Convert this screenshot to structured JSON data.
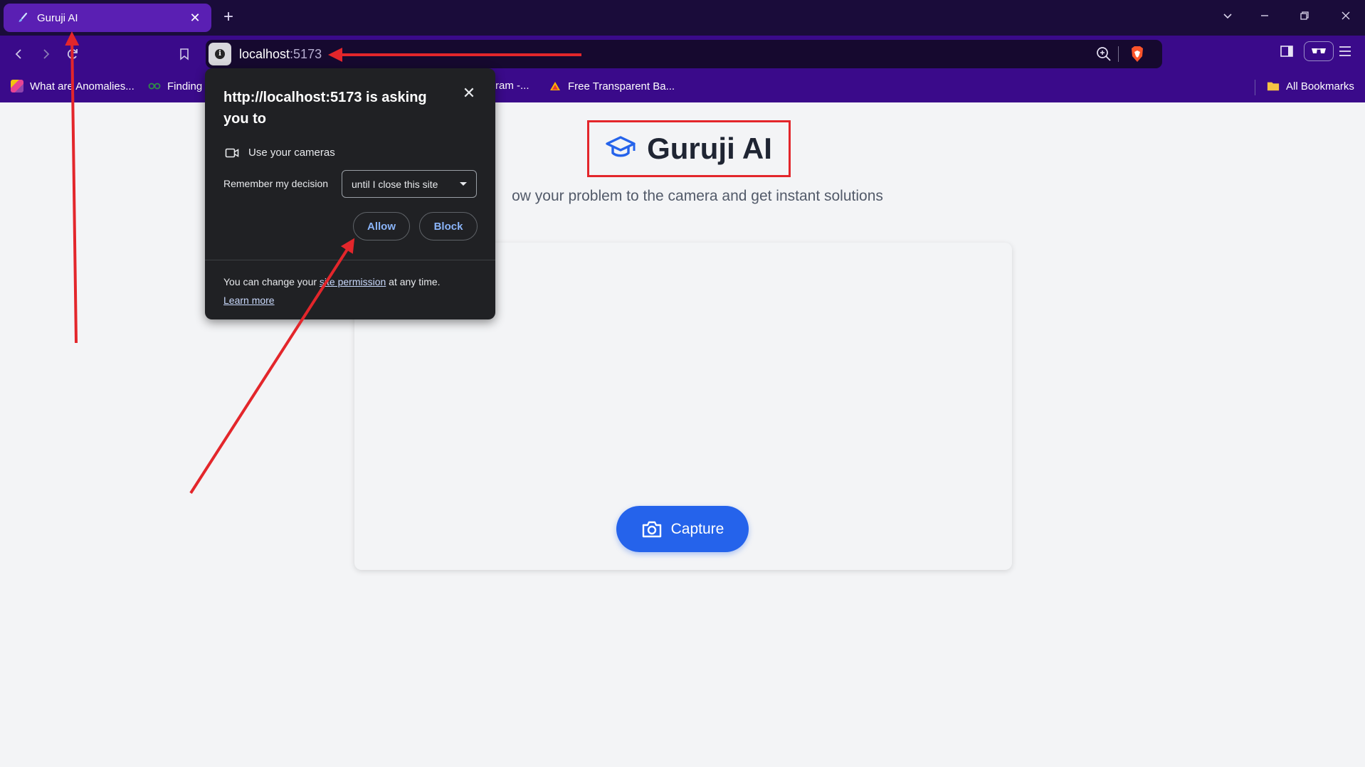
{
  "browser": {
    "tab": {
      "title": "Guruji AI",
      "close": "✕"
    },
    "new_tab": "+",
    "window_controls": {
      "tab_search": "⌄",
      "minimize": "—",
      "restore": "❐",
      "close": "✕"
    },
    "address_bar": {
      "host": "localhost",
      "port": ":5173"
    },
    "bookmarks": [
      {
        "label": "What are Anomalies...",
        "icon": "colorful-favicon"
      },
      {
        "label": "Finding",
        "icon": "gfg-favicon"
      },
      {
        "label": "ram -...",
        "icon": "generic-favicon"
      },
      {
        "label": "Free Transparent Ba...",
        "icon": "triangle-favicon"
      }
    ],
    "all_bookmarks": "All Bookmarks",
    "colors": {
      "tabstrip": "#1a0c3a",
      "toolbar": "#3a0a8a",
      "active_tab": "#5a1fb3"
    }
  },
  "page": {
    "title": "Guruji AI",
    "subtitle": "ow your problem to the camera and get instant solutions",
    "capture_label": "Capture",
    "accent": "#2563eb"
  },
  "permission_popup": {
    "title": "http://localhost:5173 is asking you to",
    "request": "Use your cameras",
    "remember_label": "Remember my decision",
    "remember_value": "until I close this site",
    "allow": "Allow",
    "block": "Block",
    "footer_prefix": "You can change your ",
    "footer_link": "site permission",
    "footer_suffix": " at any time.",
    "learn_more": "Learn more"
  },
  "annotations": {
    "color": "#e3262b"
  }
}
